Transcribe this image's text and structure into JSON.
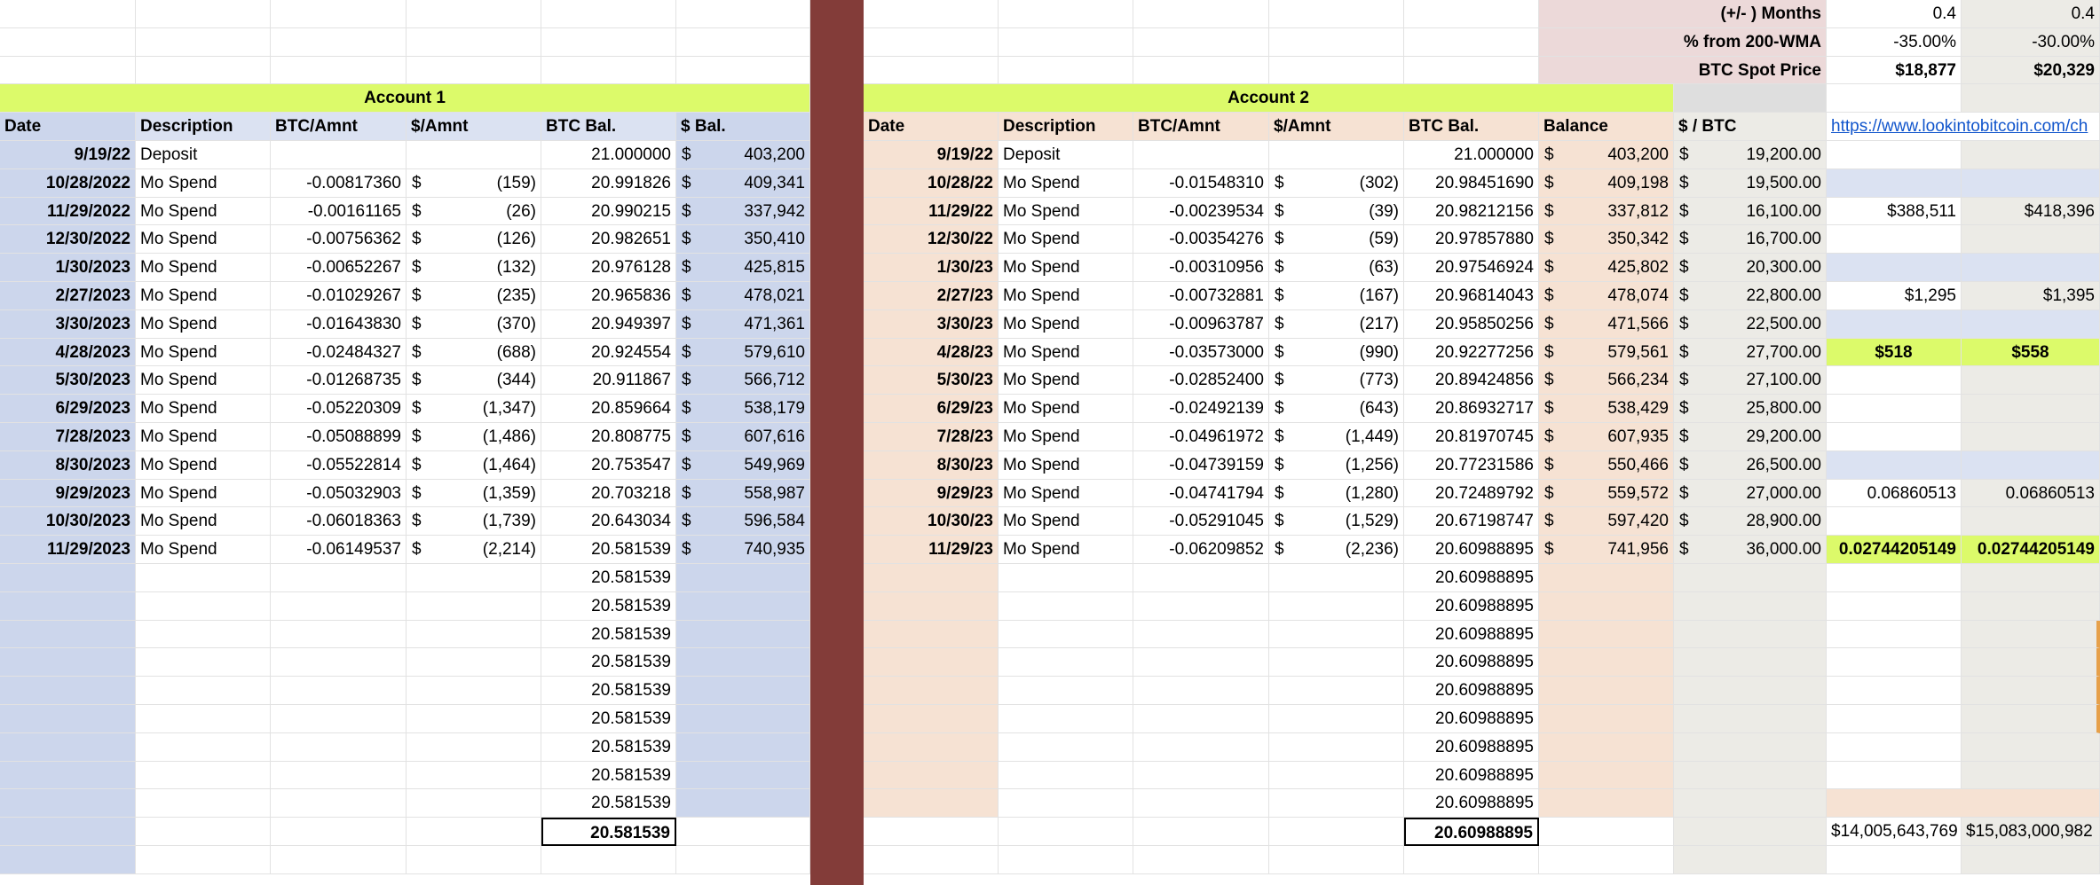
{
  "top_right": {
    "months_label": "(+/- ) Months",
    "months": [
      "0.4",
      "0.4"
    ],
    "wma_label": "% from 200-WMA",
    "wma": [
      "-35.00%",
      "-30.00%"
    ],
    "spot_label": "BTC Spot Price",
    "spot": [
      "$18,877",
      "$20,329"
    ]
  },
  "account1": {
    "title": "Account 1",
    "headers": [
      "Date",
      "Description",
      "BTC/Amnt",
      "$/Amnt",
      "BTC Bal.",
      "$ Bal."
    ],
    "rows": [
      {
        "date": "9/19/22",
        "desc": "Deposit",
        "btc": "",
        "usd": "",
        "bal": "21.000000",
        "usdbal": "403,200"
      },
      {
        "date": "10/28/2022",
        "desc": "Mo Spend",
        "btc": "-0.00817360",
        "usd": "(159)",
        "bal": "20.991826",
        "usdbal": "409,341"
      },
      {
        "date": "11/29/2022",
        "desc": "Mo Spend",
        "btc": "-0.00161165",
        "usd": "(26)",
        "bal": "20.990215",
        "usdbal": "337,942"
      },
      {
        "date": "12/30/2022",
        "desc": "Mo Spend",
        "btc": "-0.00756362",
        "usd": "(126)",
        "bal": "20.982651",
        "usdbal": "350,410"
      },
      {
        "date": "1/30/2023",
        "desc": "Mo Spend",
        "btc": "-0.00652267",
        "usd": "(132)",
        "bal": "20.976128",
        "usdbal": "425,815"
      },
      {
        "date": "2/27/2023",
        "desc": "Mo Spend",
        "btc": "-0.01029267",
        "usd": "(235)",
        "bal": "20.965836",
        "usdbal": "478,021"
      },
      {
        "date": "3/30/2023",
        "desc": "Mo Spend",
        "btc": "-0.01643830",
        "usd": "(370)",
        "bal": "20.949397",
        "usdbal": "471,361"
      },
      {
        "date": "4/28/2023",
        "desc": "Mo Spend",
        "btc": "-0.02484327",
        "usd": "(688)",
        "bal": "20.924554",
        "usdbal": "579,610"
      },
      {
        "date": "5/30/2023",
        "desc": "Mo Spend",
        "btc": "-0.01268735",
        "usd": "(344)",
        "bal": "20.911867",
        "usdbal": "566,712"
      },
      {
        "date": "6/29/2023",
        "desc": "Mo Spend",
        "btc": "-0.05220309",
        "usd": "(1,347)",
        "bal": "20.859664",
        "usdbal": "538,179"
      },
      {
        "date": "7/28/2023",
        "desc": "Mo Spend",
        "btc": "-0.05088899",
        "usd": "(1,486)",
        "bal": "20.808775",
        "usdbal": "607,616"
      },
      {
        "date": "8/30/2023",
        "desc": "Mo Spend",
        "btc": "-0.05522814",
        "usd": "(1,464)",
        "bal": "20.753547",
        "usdbal": "549,969"
      },
      {
        "date": "9/29/2023",
        "desc": "Mo Spend",
        "btc": "-0.05032903",
        "usd": "(1,359)",
        "bal": "20.703218",
        "usdbal": "558,987"
      },
      {
        "date": "10/30/2023",
        "desc": "Mo Spend",
        "btc": "-0.06018363",
        "usd": "(1,739)",
        "bal": "20.643034",
        "usdbal": "596,584"
      },
      {
        "date": "11/29/2023",
        "desc": "Mo Spend",
        "btc": "-0.06149537",
        "usd": "(2,214)",
        "bal": "20.581539",
        "usdbal": "740,935"
      }
    ],
    "trailing_bal": "20.581539",
    "total_bal": "20.581539"
  },
  "account2": {
    "title": "Account 2",
    "headers": [
      "Date",
      "Description",
      "BTC/Amnt",
      "$/Amnt",
      "BTC Bal.",
      "Balance",
      "$ / BTC"
    ],
    "rows": [
      {
        "date": "9/19/22",
        "desc": "Deposit",
        "btc": "",
        "usd": "",
        "bal": "21.000000",
        "usdbal": "403,200",
        "price": "19,200.00"
      },
      {
        "date": "10/28/22",
        "desc": "Mo Spend",
        "btc": "-0.01548310",
        "usd": "(302)",
        "bal": "20.98451690",
        "usdbal": "409,198",
        "price": "19,500.00"
      },
      {
        "date": "11/29/22",
        "desc": "Mo Spend",
        "btc": "-0.00239534",
        "usd": "(39)",
        "bal": "20.98212156",
        "usdbal": "337,812",
        "price": "16,100.00"
      },
      {
        "date": "12/30/22",
        "desc": "Mo Spend",
        "btc": "-0.00354276",
        "usd": "(59)",
        "bal": "20.97857880",
        "usdbal": "350,342",
        "price": "16,700.00"
      },
      {
        "date": "1/30/23",
        "desc": "Mo Spend",
        "btc": "-0.00310956",
        "usd": "(63)",
        "bal": "20.97546924",
        "usdbal": "425,802",
        "price": "20,300.00"
      },
      {
        "date": "2/27/23",
        "desc": "Mo Spend",
        "btc": "-0.00732881",
        "usd": "(167)",
        "bal": "20.96814043",
        "usdbal": "478,074",
        "price": "22,800.00"
      },
      {
        "date": "3/30/23",
        "desc": "Mo Spend",
        "btc": "-0.00963787",
        "usd": "(217)",
        "bal": "20.95850256",
        "usdbal": "471,566",
        "price": "22,500.00"
      },
      {
        "date": "4/28/23",
        "desc": "Mo Spend",
        "btc": "-0.03573000",
        "usd": "(990)",
        "bal": "20.92277256",
        "usdbal": "579,561",
        "price": "27,700.00"
      },
      {
        "date": "5/30/23",
        "desc": "Mo Spend",
        "btc": "-0.02852400",
        "usd": "(773)",
        "bal": "20.89424856",
        "usdbal": "566,234",
        "price": "27,100.00"
      },
      {
        "date": "6/29/23",
        "desc": "Mo Spend",
        "btc": "-0.02492139",
        "usd": "(643)",
        "bal": "20.86932717",
        "usdbal": "538,429",
        "price": "25,800.00"
      },
      {
        "date": "7/28/23",
        "desc": "Mo Spend",
        "btc": "-0.04961972",
        "usd": "(1,449)",
        "bal": "20.81970745",
        "usdbal": "607,935",
        "price": "29,200.00"
      },
      {
        "date": "8/30/23",
        "desc": "Mo Spend",
        "btc": "-0.04739159",
        "usd": "(1,256)",
        "bal": "20.77231586",
        "usdbal": "550,466",
        "price": "26,500.00"
      },
      {
        "date": "9/29/23",
        "desc": "Mo Spend",
        "btc": "-0.04741794",
        "usd": "(1,280)",
        "bal": "20.72489792",
        "usdbal": "559,572",
        "price": "27,000.00"
      },
      {
        "date": "10/30/23",
        "desc": "Mo Spend",
        "btc": "-0.05291045",
        "usd": "(1,529)",
        "bal": "20.67198747",
        "usdbal": "597,420",
        "price": "28,900.00"
      },
      {
        "date": "11/29/23",
        "desc": "Mo Spend",
        "btc": "-0.06209852",
        "usd": "(2,236)",
        "bal": "20.60988895",
        "usdbal": "741,956",
        "price": "36,000.00"
      }
    ],
    "trailing_bal": "20.60988895",
    "total_bal": "20.60988895"
  },
  "currency_symbol": "$",
  "right_panel": {
    "link": "https://www.lookintobitcoin.com/ch",
    "row2": [
      "$388,511",
      "$418,396"
    ],
    "row5": [
      "$1,295",
      "$1,395"
    ],
    "row7": [
      "$518",
      "$558"
    ],
    "row12": [
      "0.06860513",
      "0.06860513"
    ],
    "row14": [
      "0.02744205149",
      "0.02744205149"
    ],
    "bottom": [
      "$14,005,643,769",
      "$15,083,000,982"
    ]
  }
}
